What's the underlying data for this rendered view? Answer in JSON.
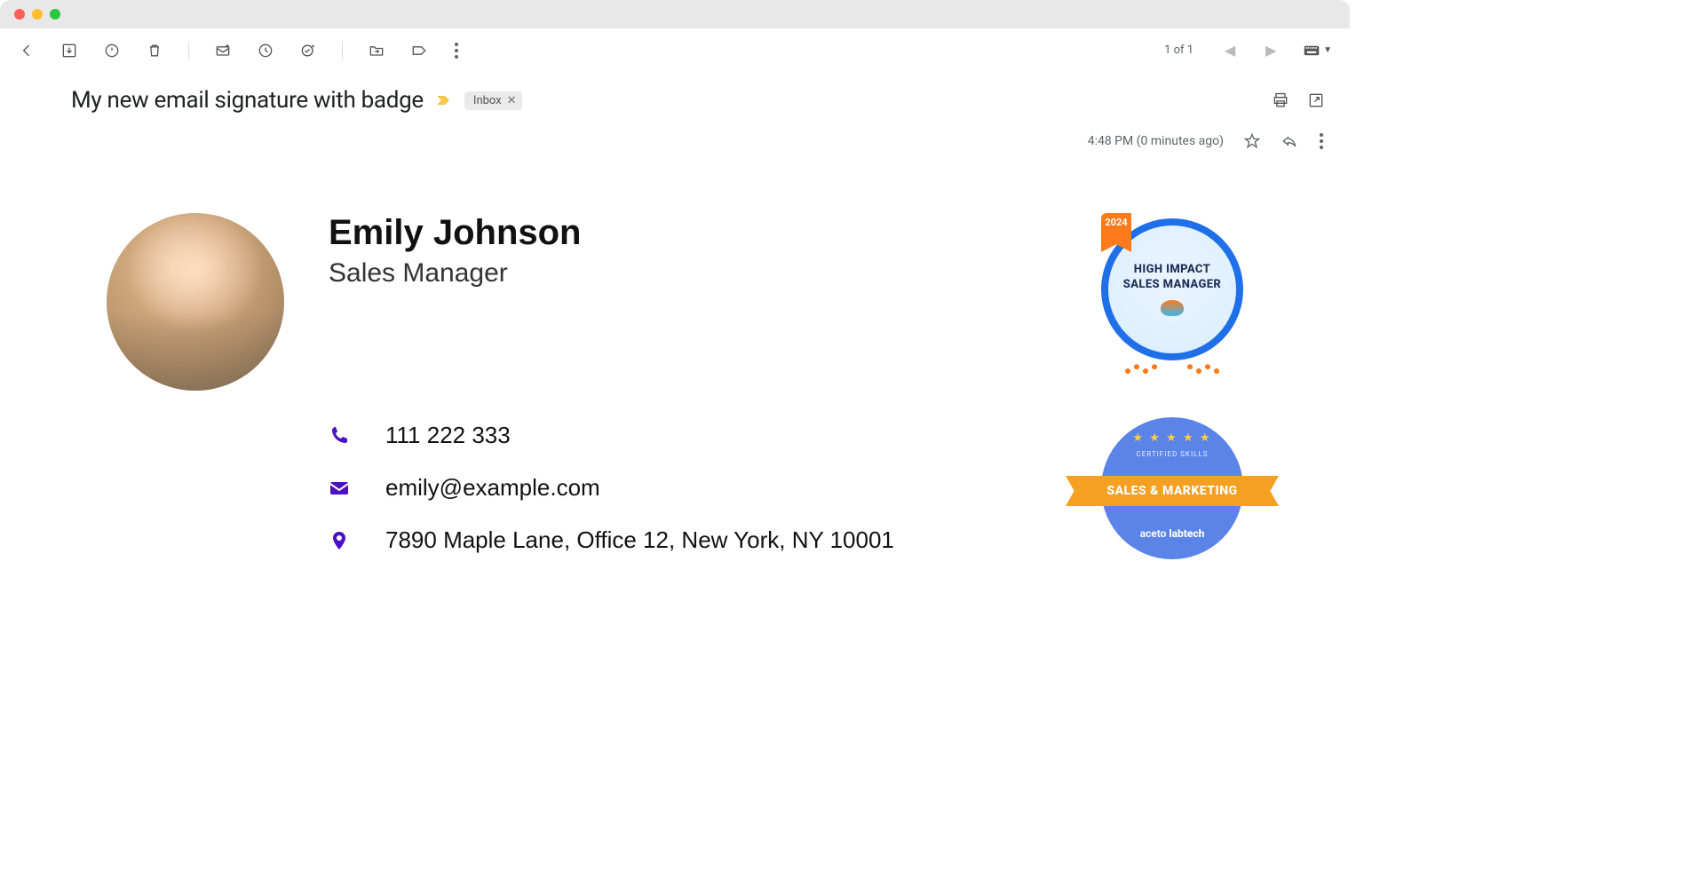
{
  "window": {
    "traffic_lights": [
      "close",
      "minimize",
      "zoom"
    ]
  },
  "toolbar": {
    "page_count": "1 of 1",
    "icons": [
      "back",
      "archive",
      "spam",
      "delete",
      "mark-unread",
      "snooze",
      "add-task",
      "move",
      "label",
      "more"
    ]
  },
  "subject": {
    "text": "My new email signature with badge",
    "label": "Inbox"
  },
  "meta": {
    "time": "4:48 PM (0 minutes ago)"
  },
  "signature": {
    "name": "Emily Johnson",
    "title": "Sales Manager",
    "phone": "111 222 333",
    "email": "emily@example.com",
    "address": "7890 Maple Lane, Office 12, New York, NY 10001"
  },
  "badges": {
    "badge1": {
      "year": "2024",
      "line1": "HIGH IMPACT",
      "line2": "SALES MANAGER"
    },
    "badge2": {
      "cert_label": "CERTIFIED SKILLS",
      "banner": "SALES & MARKETING",
      "brand_a": "aceto",
      "brand_b": " labtech"
    }
  }
}
